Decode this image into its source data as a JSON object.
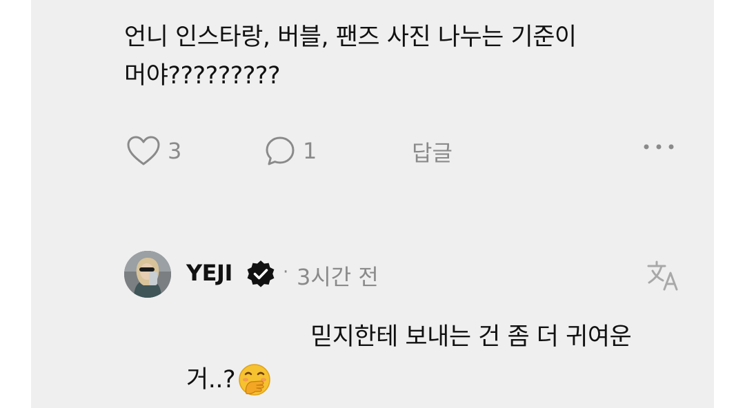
{
  "comment": {
    "line1": "언니 인스타랑, 버블, 팬즈 사진 나누는 기준이",
    "line2": "머야?????????",
    "likes": "3",
    "replies": "1",
    "reply_label": "답글"
  },
  "reply": {
    "username": "YEJI",
    "separator": "·",
    "time": "3시간 전",
    "text_line1": "믿지한테 보내는 건 좀 더 귀여운",
    "text_line2": "거..?"
  },
  "icons": {
    "like": "heart-icon",
    "comment": "speech-bubble-icon",
    "more": "more-horizontal-icon",
    "verified": "verified-badge-icon",
    "translate": "translate-icon",
    "emoji": "face-with-hand-over-mouth-emoji"
  },
  "colors": {
    "card_bg": "#efefef",
    "text_primary": "#111111",
    "text_secondary": "#8a8a8a",
    "emoji_yellow": "#f6c230"
  }
}
